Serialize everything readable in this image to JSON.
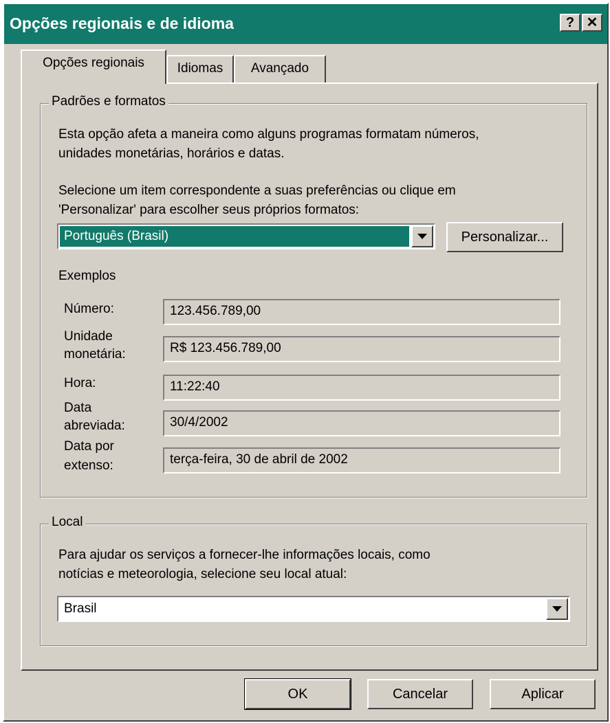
{
  "window": {
    "title": "Opções regionais e de idioma",
    "help_label": "?",
    "close_label": "✕"
  },
  "tabs": [
    {
      "label": "Opções regionais",
      "active": true
    },
    {
      "label": "Idiomas",
      "active": false
    },
    {
      "label": "Avançado",
      "active": false
    }
  ],
  "standards": {
    "legend": "Padrões e formatos",
    "desc_line1": "Esta opção afeta a maneira como alguns programas formatam números,",
    "desc_line2": "unidades monetárias, horários e datas.",
    "select_line1": "Selecione um item correspondente a suas preferências ou clique em",
    "select_line2": "'Personalizar' para escolher seus próprios formatos:",
    "locale_value": "Português (Brasil)",
    "customize_label": "Personalizar...",
    "examples_heading": "Exemplos",
    "examples": {
      "number_label": "Número:",
      "number_value": "123.456.789,00",
      "currency_label_1": "Unidade",
      "currency_label_2": "monetária:",
      "currency_value": "R$ 123.456.789,00",
      "time_label": "Hora:",
      "time_value": "11:22:40",
      "short_date_label_1": "Data",
      "short_date_label_2": "abreviada:",
      "short_date_value": "30/4/2002",
      "long_date_label_1": "Data por",
      "long_date_label_2": "extenso:",
      "long_date_value": "terça-feira, 30 de abril de 2002"
    }
  },
  "location": {
    "legend": "Local",
    "desc_line1": "Para ajudar os serviços a fornecer-lhe informações locais, como",
    "desc_line2": "notícias e meteorologia, selecione seu local atual:",
    "value": "Brasil"
  },
  "buttons": {
    "ok": "OK",
    "cancel": "Cancelar",
    "apply": "Aplicar"
  },
  "colors": {
    "titlebar": "#127a6a",
    "selection": "#127a6a",
    "face": "#d4d0c8"
  },
  "icons": [
    "help-icon",
    "close-icon",
    "chevron-down-icon"
  ]
}
